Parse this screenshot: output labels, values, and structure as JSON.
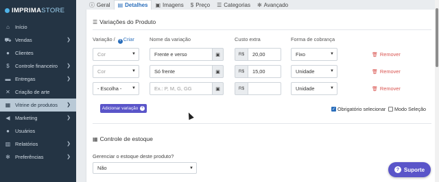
{
  "app": {
    "logo_main": "IMPRIMA",
    "logo_sub": "STORE"
  },
  "sidebar": {
    "items": [
      {
        "label": "Início",
        "icon": "home-icon",
        "glyph": "⌂",
        "chevron": false,
        "active": false
      },
      {
        "label": "Vendas",
        "icon": "cart-icon",
        "glyph": "⛟",
        "chevron": true,
        "active": false
      },
      {
        "label": "Clientes",
        "icon": "user-icon",
        "glyph": "●",
        "chevron": false,
        "active": false
      },
      {
        "label": "Controle financeiro",
        "icon": "money-icon",
        "glyph": "$",
        "chevron": true,
        "active": false
      },
      {
        "label": "Entregas",
        "icon": "truck-icon",
        "glyph": "▬",
        "chevron": true,
        "active": false
      },
      {
        "label": "Criação de arte",
        "icon": "tools-icon",
        "glyph": "✕",
        "chevron": false,
        "active": false
      },
      {
        "label": "Vitrine de produtos",
        "icon": "store-icon",
        "glyph": "▦",
        "chevron": true,
        "active": true
      },
      {
        "label": "Marketing",
        "icon": "megaphone-icon",
        "glyph": "◀",
        "chevron": true,
        "active": false
      },
      {
        "label": "Usuários",
        "icon": "users-icon",
        "glyph": "●",
        "chevron": false,
        "active": false
      },
      {
        "label": "Relatórios",
        "icon": "chart-icon",
        "glyph": "▥",
        "chevron": true,
        "active": false
      },
      {
        "label": "Preferências",
        "icon": "gears-icon",
        "glyph": "✻",
        "chevron": true,
        "active": false
      }
    ]
  },
  "tabs": [
    {
      "label": "Geral",
      "icon": "info-icon",
      "glyph": "ⓘ",
      "active": false
    },
    {
      "label": "Detalhes",
      "icon": "file-icon",
      "glyph": "▤",
      "active": true
    },
    {
      "label": "Imagens",
      "icon": "image-icon",
      "glyph": "▣",
      "active": false
    },
    {
      "label": "Preço",
      "icon": "dollar-icon",
      "glyph": "$",
      "active": false
    },
    {
      "label": "Categorias",
      "icon": "list-icon",
      "glyph": "☰",
      "active": false
    },
    {
      "label": "Avançado",
      "icon": "cogs-icon",
      "glyph": "✻",
      "active": false
    }
  ],
  "variations": {
    "title": "Variações do Produto",
    "col_variacao": "Variação /",
    "criar": "Criar",
    "col_nome": "Nome da variação",
    "col_custo": "Custo extra",
    "col_forma": "Forma de cobrança",
    "currency": "R$",
    "remove_label": "Remover",
    "rows": [
      {
        "variacao": "Cor",
        "variacao_muted": true,
        "nome": "Frente e  verso",
        "nome_placeholder": "",
        "custo": "20,00",
        "forma": "Fixo"
      },
      {
        "variacao": "Cor",
        "variacao_muted": true,
        "nome": "Só frente",
        "nome_placeholder": "",
        "custo": "15,00",
        "forma": "Unidade"
      },
      {
        "variacao": "- Escolha -",
        "variacao_muted": false,
        "nome": "",
        "nome_placeholder": "Ex.: P, M, G, GG",
        "custo": "",
        "forma": "Unidade"
      }
    ],
    "add_button": "Adicionar variação",
    "checkbox_obrigatorio": {
      "label": "Obrigatório selecionar",
      "checked": true
    },
    "checkbox_modo": {
      "label": "Modo Seleção",
      "checked": false
    }
  },
  "stock": {
    "title": "Controle de estoque",
    "question": "Gerenciar o estoque deste produto?",
    "value": "Não"
  },
  "support": {
    "label": "Suporte"
  }
}
